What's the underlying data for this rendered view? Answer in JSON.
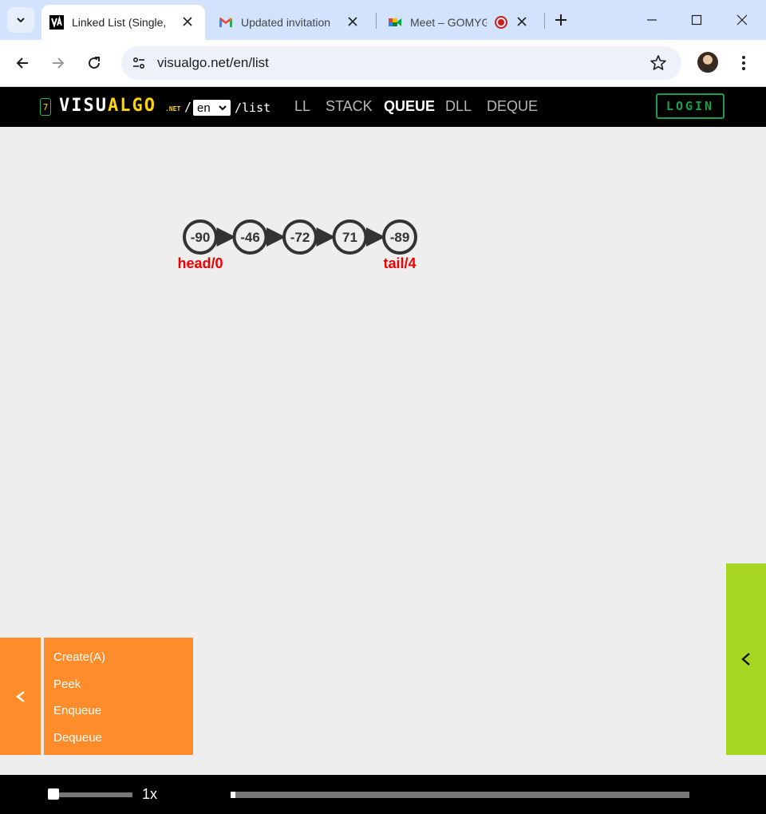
{
  "browser": {
    "tabs": [
      {
        "title": "Linked List (Single,",
        "active": true,
        "favicon": "visualgo-icon"
      },
      {
        "title": "Updated invitation",
        "active": false,
        "favicon": "gmail-icon"
      },
      {
        "title": "Meet – GOMYG",
        "active": false,
        "favicon": "google-meet-icon"
      }
    ],
    "url": "visualgo.net/en/list"
  },
  "header": {
    "count": "7",
    "logo_visu": "VISU",
    "logo_algo": "ALGO",
    "logo_net": ".NET",
    "slash": "/",
    "language": "en",
    "path": "/list",
    "modes": [
      "LL",
      "STACK",
      "QUEUE",
      "DLL",
      "DEQUE"
    ],
    "active_mode": "QUEUE",
    "login_label": "LOGIN"
  },
  "visualization": {
    "nodes": [
      "-90",
      "-46",
      "-72",
      "71",
      "-89"
    ],
    "head_label": "head/0",
    "tail_label": "tail/4",
    "label_color": "#ee0000"
  },
  "actions": {
    "toggle_label": "<",
    "items": [
      "Create(A)",
      "Peek",
      "Enqueue",
      "Dequeue"
    ]
  },
  "status_panel": {
    "toggle_label": "<"
  },
  "media": {
    "speed_label": "1x",
    "speed_fraction": 0.0,
    "progress_fraction": 0.01
  },
  "colors": {
    "actions_bg": "#ff8c2a",
    "status_bg": "#a7d622",
    "login_green": "#1a9e4f",
    "logo_yellow": "#ffd400"
  }
}
